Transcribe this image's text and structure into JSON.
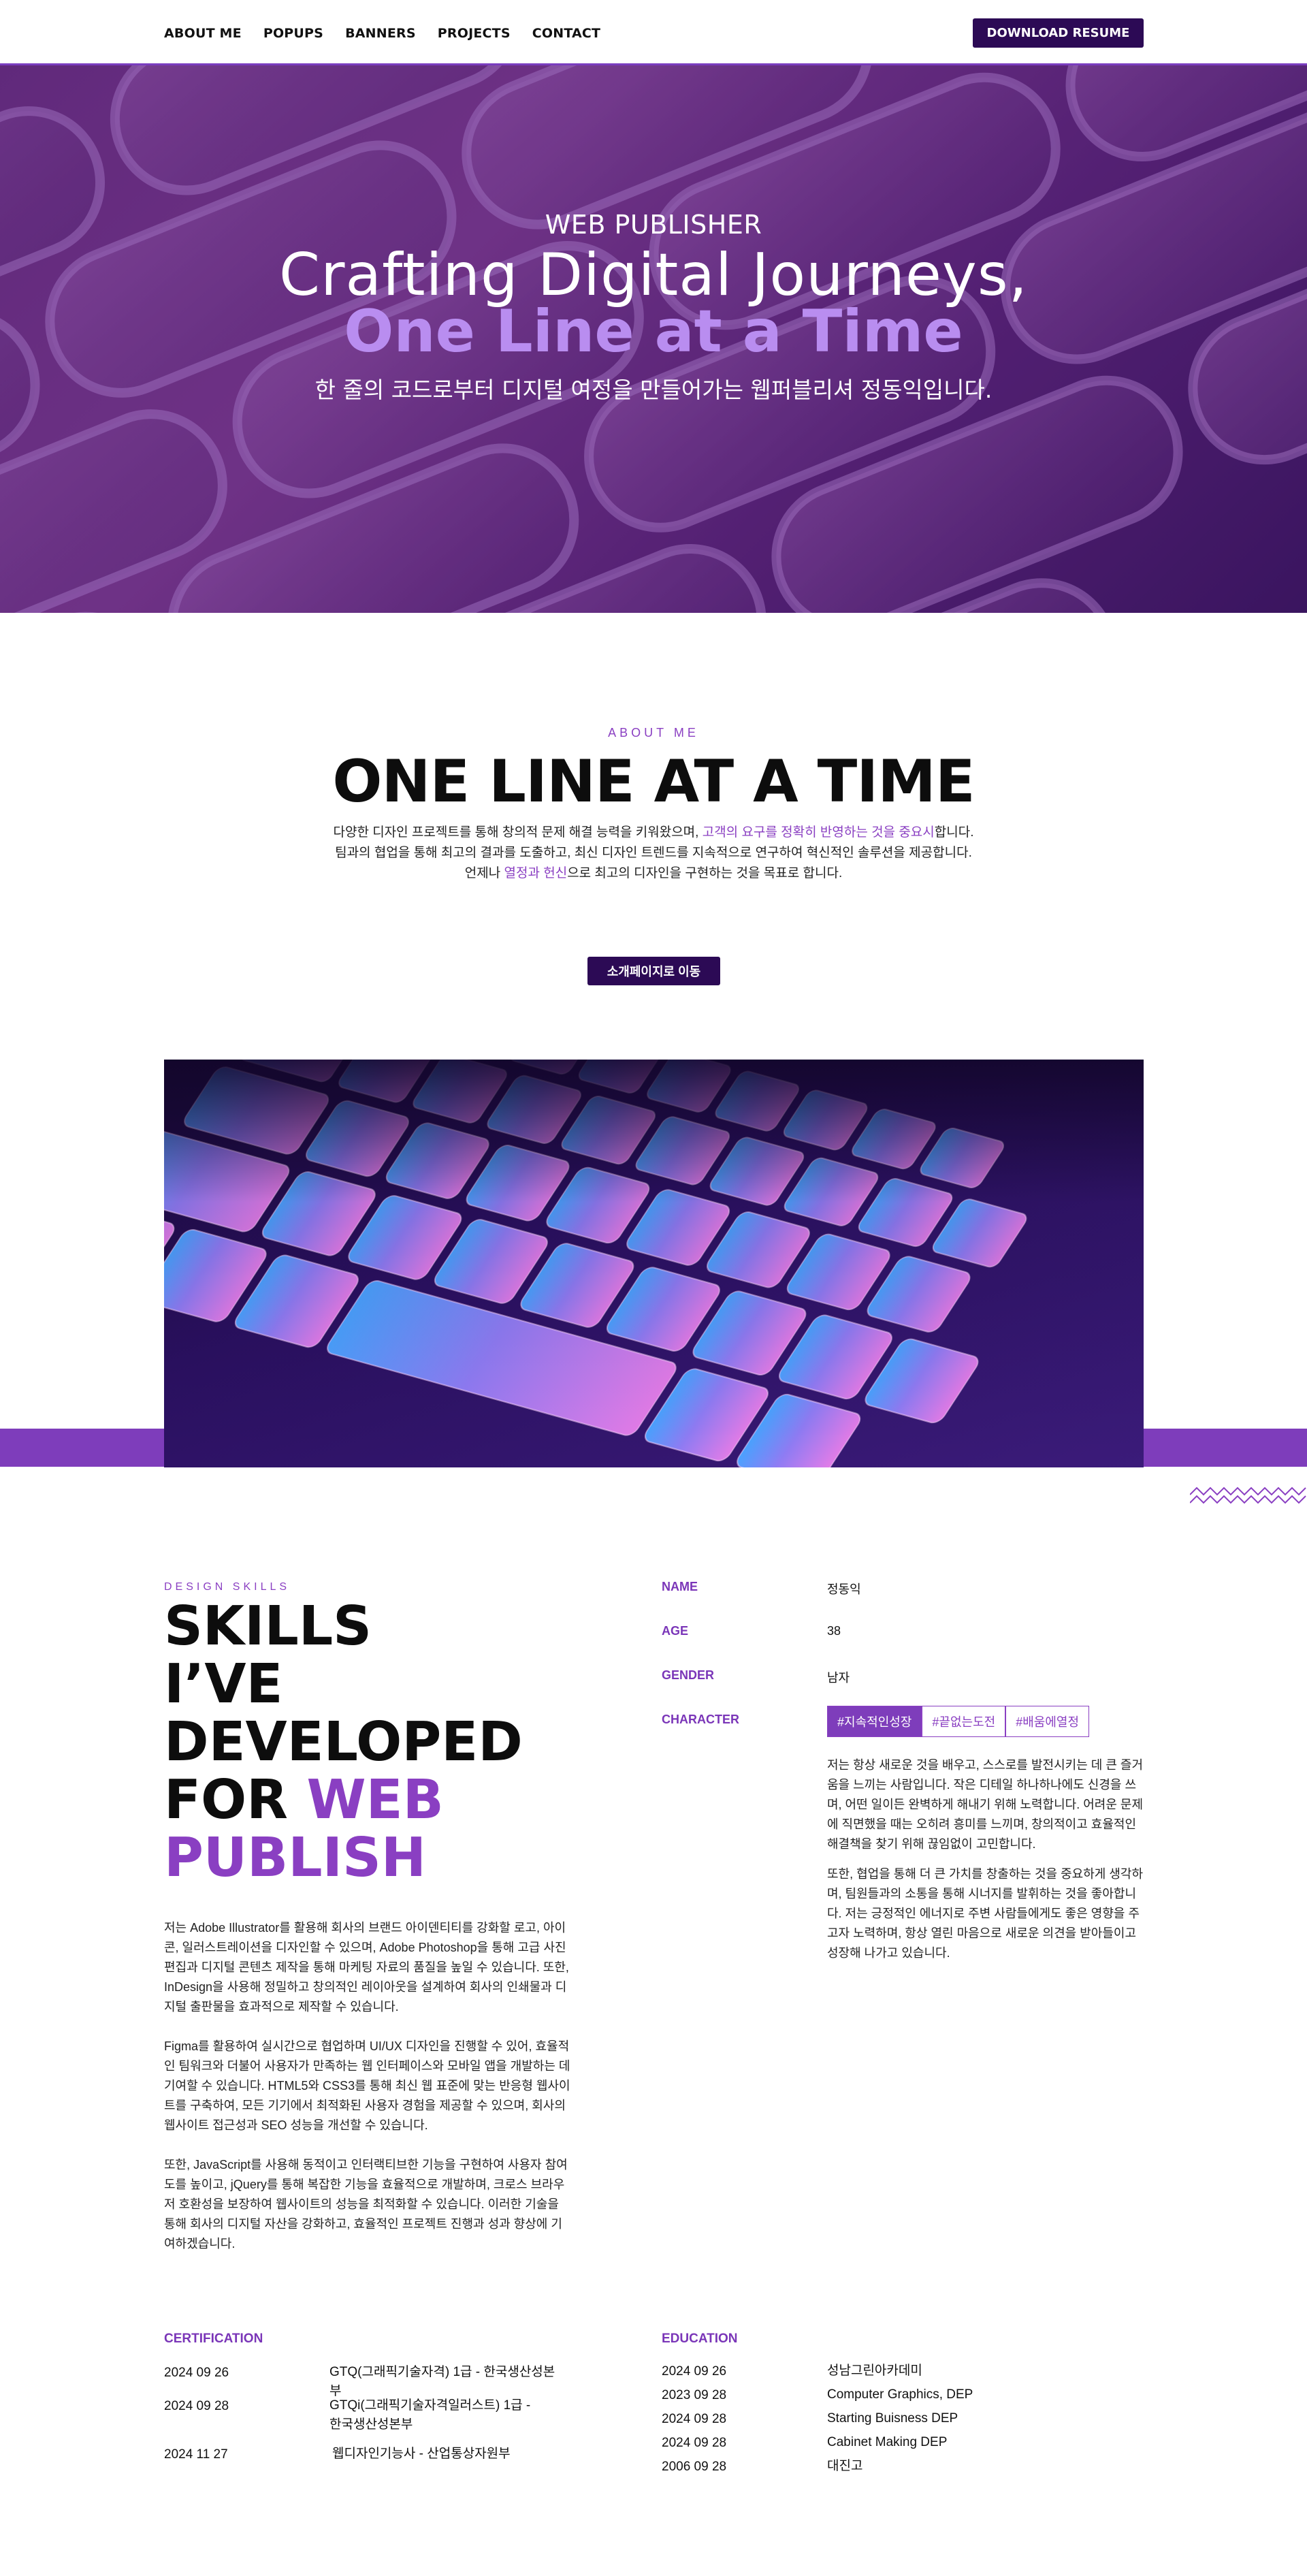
{
  "nav": {
    "links": [
      "ABOUT ME",
      "POPUPS",
      "BANNERS",
      "PROJECTS",
      "CONTACT"
    ],
    "resume_button": "DOWNLOAD RESUME"
  },
  "hero": {
    "subtitle": "WEB PUBLISHER",
    "title_line1": "Crafting Digital Journeys,",
    "title_line2": "One Line at a Time",
    "tagline": "한 줄의 코드로부터 디지털 여정을 만들어가는 웹퍼블리셔 정동익입니다."
  },
  "about": {
    "label": "ABOUT ME",
    "title": "ONE LINE AT A TIME",
    "line1_a": "다양한 디자인 프로젝트를 통해 창의적 문제 해결 능력을 키워왔으며, ",
    "line1_hl": "고객의 요구를 정확히 반영하는 것을 중요시",
    "line1_b": "합니다.",
    "line2": "팀과의 협업을 통해 최고의 결과를 도출하고, 최신 디자인 트렌드를 지속적으로 연구하여 혁신적인 솔루션을 제공합니다.",
    "line3_a": "언제나 ",
    "line3_hl": "열정과 헌신",
    "line3_b": "으로 최고의 디자인을 구현하는 것을 목표로 합니다.",
    "button": "소개페이지로 이동"
  },
  "skills": {
    "label": "DESIGN SKILLS",
    "title_l1": "SKILLS",
    "title_l2": "I’VE",
    "title_l3": "DEVELOPED",
    "title_l4a": "FOR ",
    "title_l4b": "WEB",
    "title_l5": "PUBLISH",
    "para1": "저는 Adobe Illustrator를 활용해 회사의 브랜드 아이덴티티를 강화할 로고, 아이콘, 일러스트레이션을 디자인할 수 있으며, Adobe Photoshop을 통해 고급 사진 편집과 디지털 콘텐츠 제작을 통해 마케팅 자료의 품질을 높일 수 있습니다. 또한, InDesign을 사용해 정밀하고 창의적인 레이아웃을 설계하여 회사의 인쇄물과 디지털 출판물을 효과적으로 제작할 수 있습니다.",
    "para2": "Figma를 활용하여 실시간으로 협업하며 UI/UX 디자인을 진행할 수 있어, 효율적인 팀워크와 더불어 사용자가 만족하는 웹 인터페이스와 모바일 앱을 개발하는 데 기여할 수 있습니다. HTML5와 CSS3를 통해 최신 웹 표준에 맞는 반응형 웹사이트를 구축하여, 모든 기기에서 최적화된 사용자 경험을 제공할 수 있으며, 회사의 웹사이트 접근성과 SEO 성능을 개선할 수 있습니다.",
    "para3": "또한, JavaScript를 사용해 동적이고 인터랙티브한 기능을 구현하여 사용자 참여도를 높이고, jQuery를 통해 복잡한 기능을 효율적으로 개발하며, 크로스 브라우저 호환성을 보장하여 웹사이트의 성능을 최적화할 수 있습니다. 이러한 기술을 통해 회사의 디지털 자산을 강화하고, 효율적인 프로젝트 진행과 성과 향상에 기여하겠습니다."
  },
  "profile": {
    "name_label": "NAME",
    "name": "정동익",
    "age_label": "AGE",
    "age": "38",
    "gender_label": "GENDER",
    "gender": "남자",
    "character_label": "CHARACTER",
    "tags": [
      "#지속적인성장",
      "#끝없는도전",
      "#배움에열정"
    ],
    "para1": "저는 항상 새로운 것을 배우고, 스스로를 발전시키는 데 큰 즐거움을 느끼는 사람입니다. 작은 디테일 하나하나에도 신경을 쓰며, 어떤 일이든 완벽하게 해내기 위해 노력합니다. 어려운 문제에 직면했을 때는 오히려 흥미를 느끼며, 창의적이고 효율적인 해결책을 찾기 위해 끊임없이 고민합니다.",
    "para2": "또한, 협업을 통해 더 큰 가치를 창출하는 것을 중요하게 생각하며, 팀원들과의 소통을 통해 시너지를 발휘하는 것을 좋아합니다. 저는 긍정적인 에너지로 주변 사람들에게도 좋은 영향을 주고자 노력하며, 항상 열린 마음으로 새로운 의견을 받아들이고 성장해 나가고 있습니다."
  },
  "certification": {
    "heading": "CERTIFICATION",
    "rows": [
      {
        "date": "2024 09 26",
        "text": "GTQ(그래픽기술자격) 1급 - 한국생산성본부"
      },
      {
        "date": "2024 09 28",
        "text": "GTQi(그래픽기술자격일러스트) 1급 - 한국생산성본부"
      },
      {
        "date": "2024 11 27",
        "text": "웹디자인기능사 - 산업통상자원부"
      }
    ]
  },
  "education": {
    "heading": "EDUCATION",
    "rows": [
      {
        "date": "2024 09 26",
        "text": "성남그린아카데미"
      },
      {
        "date": "2023 09 28",
        "text": "Computer Graphics, DEP"
      },
      {
        "date": "2024 09 28",
        "text": "Starting Buisness DEP"
      },
      {
        "date": "2024 09 28",
        "text": "Cabinet Making DEP"
      },
      {
        "date": "2006 09 28",
        "text": "대진고"
      }
    ]
  },
  "colors": {
    "accent": "#8a3fc2",
    "dark_button": "#2c0a55",
    "band": "#7e3dbb"
  }
}
